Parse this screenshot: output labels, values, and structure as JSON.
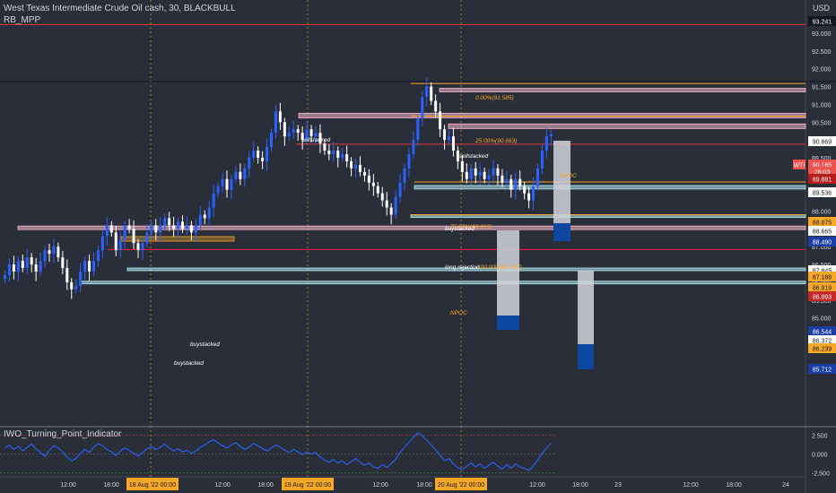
{
  "header": {
    "symbol_title": "West Texas Intermediate Crude Oil cash, 30, BLACKBULL",
    "indicator_label": "RB_MPP",
    "sub_indicator_label": "IWO_Turning_Point_Indicator"
  },
  "axis": {
    "currency": "USD",
    "price_ticks": [
      "93.000",
      "92.500",
      "92.000",
      "91.500",
      "91.000",
      "90.500",
      "90.000",
      "89.500",
      "89.000",
      "88.500",
      "88.000",
      "87.500",
      "87.000",
      "86.500",
      "86.000",
      "85.500",
      "85.000",
      "84.500"
    ],
    "time_ticks": [
      "12:00",
      "18:00",
      "18 Aug '22  00:00",
      "12:00",
      "18:00",
      "19 Aug '22  00:00",
      "12:00",
      "18:00",
      "20 Aug '22  00:00",
      "12:00",
      "18:00",
      "23",
      "12:00",
      "18:00",
      "24"
    ],
    "osc_ticks": [
      "2.500",
      "0.000",
      "-2.500"
    ]
  },
  "price_labels": [
    {
      "text": "93.241",
      "bg": "#131722",
      "fg": "#ffffff"
    },
    {
      "text": "90.669",
      "bg": "#ffffff",
      "fg": "#131722"
    },
    {
      "text": "WTI",
      "bg": "#ef5350",
      "fg": "#ffffff"
    },
    {
      "text": "90.165",
      "bg": "#ef5350",
      "fg": "#ffffff"
    },
    {
      "text": "26:03",
      "bg": "#ef5350",
      "fg": "#ffffff"
    },
    {
      "text": "89.881",
      "bg": "#b71c1c",
      "fg": "#ffffff"
    },
    {
      "text": "89.536",
      "bg": "#ffffff",
      "fg": "#131722"
    },
    {
      "text": "88.875",
      "bg": "#f9a825",
      "fg": "#131722"
    },
    {
      "text": "88.665",
      "bg": "#ffffff",
      "fg": "#131722"
    },
    {
      "text": "88.490",
      "bg": "#1a3ea6",
      "fg": "#ffffff"
    },
    {
      "text": "87.845",
      "bg": "#ffffff",
      "fg": "#131722"
    },
    {
      "text": "87.188",
      "bg": "#f9a825",
      "fg": "#131722"
    },
    {
      "text": "86.919",
      "bg": "#f9a825",
      "fg": "#131722"
    },
    {
      "text": "86.893",
      "bg": "#c62828",
      "fg": "#ffffff"
    },
    {
      "text": "86.544",
      "bg": "#1a3ea6",
      "fg": "#ffffff"
    },
    {
      "text": "86.372",
      "bg": "#ffffff",
      "fg": "#131722"
    },
    {
      "text": "86.239",
      "bg": "#f9a825",
      "fg": "#131722"
    },
    {
      "text": "85.712",
      "bg": "#1a3ea6",
      "fg": "#ffffff"
    }
  ],
  "annotations": [
    {
      "text": "0.00%(91.585)",
      "color": "#f9a825"
    },
    {
      "text": "25.00%(90.663)",
      "color": "#f9a825"
    },
    {
      "text": "75.00%(88.819)",
      "color": "#f9a825"
    },
    {
      "text": "100.00%(87.897)",
      "color": "#f9a825"
    },
    {
      "text": "sellstacked",
      "color": "#ffffff"
    },
    {
      "text": "sellstacked",
      "color": "#ffffff"
    },
    {
      "text": "buystacked",
      "color": "#ffffff"
    },
    {
      "text": "buystacked",
      "color": "#ffffff"
    },
    {
      "text": "buystacked",
      "color": "#ffffff"
    },
    {
      "text": "long rejection",
      "color": "#ffffff"
    },
    {
      "text": "NPOC",
      "color": "#f9a825"
    },
    {
      "text": "NPOC",
      "color": "#f9a825"
    }
  ],
  "chart_data": {
    "type": "candlestick",
    "title": "West Texas Intermediate Crude Oil cash, 30, BLACKBULL",
    "ylim": [
      84.5,
      93.3
    ],
    "y_scale": "linear",
    "last_price": 90.165,
    "high": 91.585,
    "low": 85.45,
    "colors": {
      "up": "#2962ff",
      "down": "#ffffff",
      "background": "#2a2e39",
      "resistance_zone": "#f8bbd0",
      "support_zone": "#b2ebf2",
      "level_red": "#e53935",
      "level_orange": "#f9a825"
    },
    "close_path": [
      86.2,
      86.5,
      86.3,
      86.6,
      86.4,
      86.7,
      86.5,
      86.3,
      86.6,
      86.9,
      86.8,
      87.0,
      86.7,
      86.4,
      86.0,
      85.8,
      85.9,
      86.3,
      86.6,
      86.3,
      86.6,
      86.9,
      87.3,
      87.6,
      87.4,
      86.9,
      87.2,
      87.6,
      87.5,
      87.1,
      86.9,
      87.1,
      87.4,
      87.6,
      87.4,
      87.6,
      87.8,
      87.6,
      87.5,
      87.7,
      87.5,
      87.6,
      87.4,
      87.6,
      87.9,
      87.8,
      88.1,
      88.5,
      88.7,
      88.9,
      88.6,
      88.9,
      89.1,
      88.9,
      89.2,
      89.5,
      89.7,
      89.5,
      89.4,
      89.8,
      90.2,
      90.8,
      90.5,
      90.1,
      90.2,
      90.3,
      90.2,
      90.0,
      90.3,
      90.1,
      90.2,
      89.9,
      89.7,
      89.6,
      89.7,
      89.5,
      89.6,
      89.4,
      89.2,
      89.3,
      89.1,
      89.0,
      88.8,
      88.7,
      88.5,
      88.3,
      88.1,
      87.9,
      88.4,
      88.8,
      89.2,
      89.6,
      90.0,
      90.6,
      91.2,
      91.5,
      91.1,
      90.8,
      90.3,
      90.0,
      90.1,
      89.7,
      89.4,
      89.1,
      88.9,
      89.2,
      89.0,
      89.1,
      88.9,
      89.0,
      89.2,
      89.0,
      88.8,
      88.9,
      88.6,
      88.9,
      88.7,
      88.5,
      88.3,
      88.7,
      89.2,
      89.7,
      90.1,
      90.165
    ],
    "oscillator": {
      "name": "IWO_Turning_Point_Indicator",
      "ylim": [
        -4,
        3
      ],
      "values": [
        0.8,
        1.2,
        0.6,
        1.0,
        0.4,
        0.9,
        1.3,
        0.7,
        0.2,
        -0.3,
        0.5,
        1.1,
        0.8,
        0.3,
        -0.4,
        -0.9,
        -0.6,
        0.1,
        0.6,
        0.2,
        0.9,
        1.4,
        1.1,
        0.6,
        0.3,
        -0.2,
        0.4,
        0.8,
        0.5,
        0.1,
        -0.3,
        0.2,
        0.7,
        1.0,
        0.6,
        0.9,
        1.3,
        0.8,
        0.4,
        0.7,
        0.3,
        0.5,
        0.1,
        0.4,
        0.9,
        1.2,
        1.6,
        1.9,
        1.5,
        1.1,
        0.8,
        1.2,
        1.5,
        1.0,
        0.6,
        0.9,
        1.4,
        1.1,
        0.7,
        0.4,
        0.8,
        1.2,
        0.9,
        0.5,
        0.2,
        0.6,
        0.3,
        -0.1,
        0.3,
        0.0,
        0.2,
        -0.4,
        -0.8,
        -1.1,
        -0.7,
        -1.2,
        -0.9,
        -1.4,
        -1.0,
        -0.6,
        -1.1,
        -1.5,
        -1.2,
        -1.7,
        -1.9,
        -1.4,
        -1.8,
        -1.3,
        -0.7,
        0.2,
        0.9,
        1.6,
        2.2,
        2.8,
        2.4,
        1.8,
        1.2,
        0.6,
        -0.2,
        -0.9,
        -0.6,
        -1.3,
        -1.8,
        -2.1,
        -1.6,
        -1.2,
        -1.7,
        -1.3,
        -1.9,
        -1.5,
        -1.1,
        -1.6,
        -2.0,
        -1.4,
        -1.9,
        -1.3,
        -1.7,
        -1.9,
        -2.2,
        -1.6,
        -0.8,
        0.1,
        0.8,
        1.4
      ]
    },
    "levels": [
      {
        "price": 93.241,
        "color": "#e53935"
      },
      {
        "price": 91.585,
        "color": "#f9a825"
      },
      {
        "price": 90.669,
        "color": "#f9a825"
      },
      {
        "price": 89.881,
        "color": "#e53935"
      },
      {
        "price": 88.819,
        "color": "#f9a825"
      },
      {
        "price": 87.897,
        "color": "#f9a825"
      },
      {
        "price": 86.919,
        "color": "#ff1744"
      }
    ],
    "zones": [
      {
        "from": 91.45,
        "to": 91.35,
        "kind": "resistance"
      },
      {
        "from": 90.75,
        "to": 90.62,
        "kind": "resistance"
      },
      {
        "from": 90.45,
        "to": 90.32,
        "kind": "resistance"
      },
      {
        "from": 87.58,
        "to": 87.48,
        "kind": "resistance"
      },
      {
        "from": 88.72,
        "to": 88.62,
        "kind": "support"
      },
      {
        "from": 87.9,
        "to": 87.82,
        "kind": "support"
      },
      {
        "from": 86.4,
        "to": 86.35,
        "kind": "support"
      },
      {
        "from": 86.03,
        "to": 85.97,
        "kind": "support"
      }
    ]
  }
}
